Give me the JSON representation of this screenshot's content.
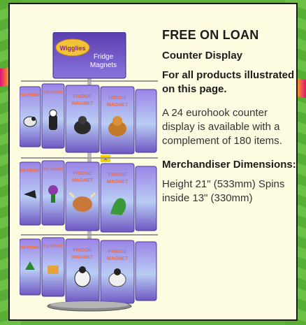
{
  "header_card": {
    "brand": "Wigglies",
    "caption_line1": "Fridge",
    "caption_line2": "Magnets"
  },
  "card_labels": {
    "keyring": "KEYRING",
    "fridge_magnet": "FRIDGE MAGNET"
  },
  "info": {
    "title": "FREE ON LOAN",
    "subtitle": "Counter Display",
    "note": "For all products illustrated on this page.",
    "body": "A 24 eurohook counter display is available with a complement of 180 items.",
    "dims_heading": "Merchandiser Dimensions:",
    "dims_body": "Height 21\" (533mm) Spins inside 13\" (330mm)"
  },
  "colors": {
    "panel": "#fefde2",
    "background_green": "#5fb23a",
    "card_purple": "#7a5fc8",
    "card_sky": "#a9c8f3",
    "text": "#1c1c1c"
  }
}
